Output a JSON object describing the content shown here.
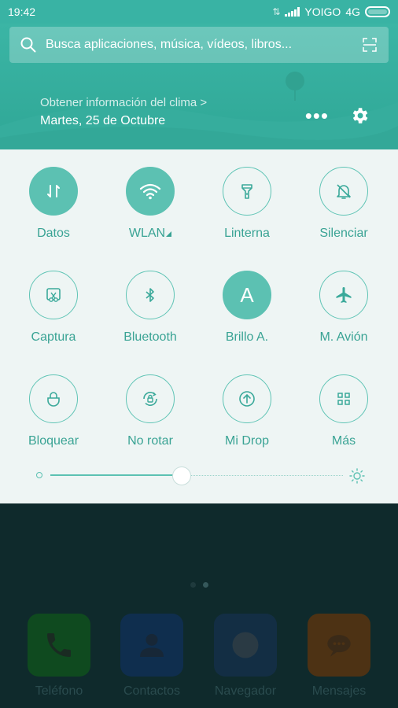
{
  "status_bar": {
    "time": "19:42",
    "carrier": "YOIGO",
    "network": "4G"
  },
  "header": {
    "search_placeholder": "Busca aplicaciones, música, vídeos, libros...",
    "weather_link": "Obtener información del clima >",
    "date": "Martes, 25 de Octubre"
  },
  "quick_settings": {
    "tiles": [
      {
        "label": "Datos",
        "icon": "data-transfer-icon",
        "active": true
      },
      {
        "label": "WLAN",
        "icon": "wifi-icon",
        "active": true
      },
      {
        "label": "Linterna",
        "icon": "flashlight-icon",
        "active": false
      },
      {
        "label": "Silenciar",
        "icon": "bell-off-icon",
        "active": false
      },
      {
        "label": "Captura",
        "icon": "screenshot-icon",
        "active": false
      },
      {
        "label": "Bluetooth",
        "icon": "bluetooth-icon",
        "active": false
      },
      {
        "label": "Brillo A.",
        "icon": "auto-brightness-icon",
        "active": true,
        "glyph": "A"
      },
      {
        "label": "M. Avión",
        "icon": "airplane-icon",
        "active": false
      },
      {
        "label": "Bloquear",
        "icon": "lock-icon",
        "active": false
      },
      {
        "label": "No rotar",
        "icon": "rotation-lock-icon",
        "active": false
      },
      {
        "label": "Mi Drop",
        "icon": "upload-icon",
        "active": false
      },
      {
        "label": "Más",
        "icon": "grid-icon",
        "active": false
      }
    ],
    "brightness": 0.45
  },
  "dock": {
    "apps": [
      {
        "label": "Teléfono",
        "icon": "phone-icon",
        "color": "#0f4a1f"
      },
      {
        "label": "Contactos",
        "icon": "contacts-icon",
        "color": "#0f2e4e"
      },
      {
        "label": "Navegador",
        "icon": "browser-icon",
        "color": "#132e44"
      },
      {
        "label": "Mensajes",
        "icon": "messages-icon",
        "color": "#4d3214"
      }
    ]
  },
  "colors": {
    "accent": "#5cc1b2",
    "header": "#39b3a4",
    "panel_bg": "#eef5f4"
  }
}
